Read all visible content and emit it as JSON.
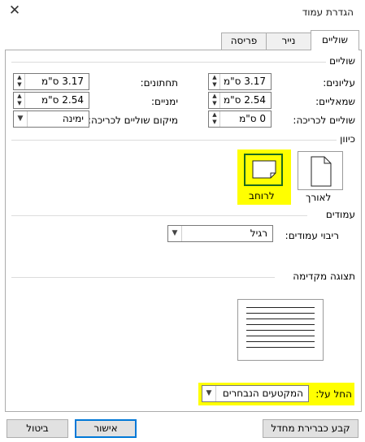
{
  "window": {
    "title": "הגדרת עמוד",
    "close_icon": "close-icon"
  },
  "tabs": [
    {
      "label": "שוליים",
      "active": true
    },
    {
      "label": "נייר",
      "active": false
    },
    {
      "label": "פריסה",
      "active": false
    }
  ],
  "margins": {
    "group_label": "שוליים",
    "top": {
      "label": "עליונים:",
      "value": "3.17 ס\"מ"
    },
    "bottom": {
      "label": "תחתונים:",
      "value": "3.17 ס\"מ"
    },
    "left": {
      "label": "שמאליים:",
      "value": "2.54 ס\"מ"
    },
    "right": {
      "label": "ימניים:",
      "value": "2.54 ס\"מ"
    },
    "gutter": {
      "label": "שוליים לכריכה:",
      "value": "0 ס\"מ"
    },
    "gutter_position": {
      "label": "מיקום שוליים לכריכה:",
      "value": "ימינה"
    }
  },
  "orientation": {
    "group_label": "כיוון",
    "portrait_label": "לאורך",
    "landscape_label": "לרוחב",
    "selected": "landscape",
    "highlight_color": "#ffff00"
  },
  "pages": {
    "group_label": "עמודים",
    "multiple_pages_label": "ריבוי עמודים:",
    "multiple_pages_value": "רגיל"
  },
  "preview": {
    "group_label": "תצוגה מקדימה"
  },
  "apply_to": {
    "label": "החל על:",
    "value": "המקטעים הנבחרים"
  },
  "buttons": {
    "set_default": "קבע כברירת מחדל",
    "ok": "אישור",
    "cancel": "ביטול"
  }
}
